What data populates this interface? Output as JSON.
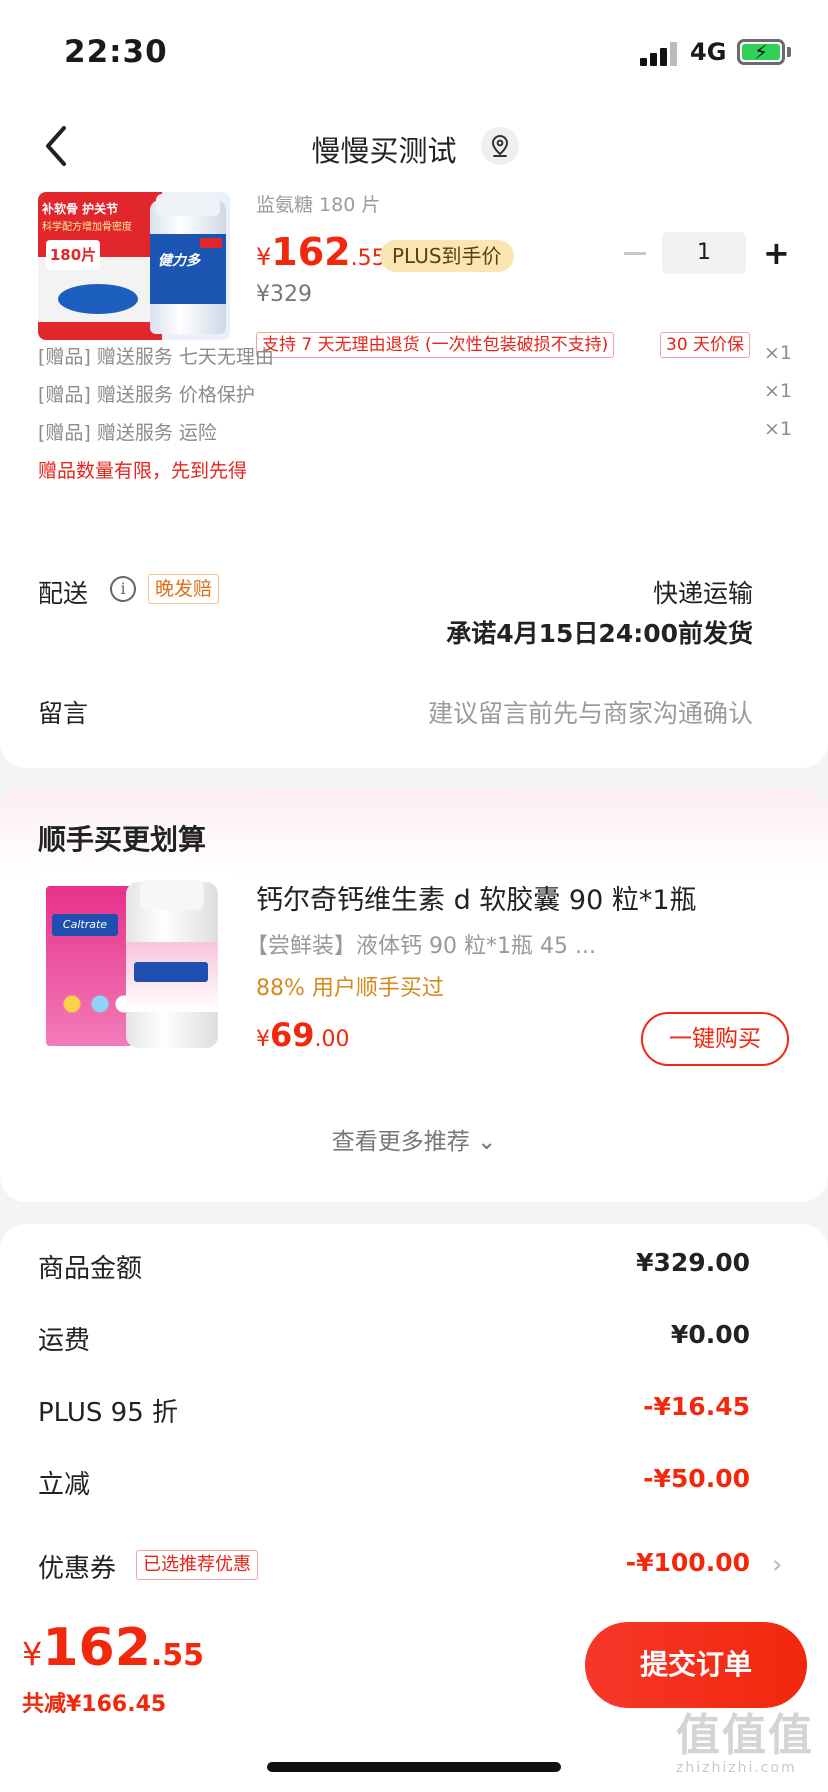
{
  "status_bar": {
    "time": "22:30",
    "network": "4G"
  },
  "nav": {
    "title": "慢慢买测试",
    "back_icon": "chevron-left-icon",
    "location_icon": "location-pin-icon"
  },
  "product": {
    "subtitle": "监氨糖 180 片",
    "price": {
      "symbol": "¥",
      "integer": "162",
      "decimal": ".55"
    },
    "plus_tag": "PLUS到手价",
    "quantity": "1",
    "original_price": "¥329",
    "tags": [
      "支持 7 天无理由退货 (一次性包装破损不支持)",
      "30 天价保"
    ],
    "image": {
      "line1": "补软骨 护关节",
      "line2": "科学配方增加骨密度",
      "count": "180片",
      "brand": "健力多"
    }
  },
  "gifts": [
    {
      "label": "[赠品]  赠送服务  七天无理由",
      "qty": "×1"
    },
    {
      "label": "[赠品]  赠送服务  价格保护",
      "qty": "×1"
    },
    {
      "label": "[赠品]  赠送服务  运险",
      "qty": "×1"
    }
  ],
  "gift_note": "赠品数量有限，先到先得",
  "delivery": {
    "label": "配送",
    "late_tag": "晚发赔",
    "method": "快递运输",
    "promise": "承诺4月15日24:00前发货"
  },
  "message": {
    "label": "留言",
    "placeholder": "建议留言前先与商家沟通确认"
  },
  "recommend": {
    "heading": "顺手买更划算",
    "name": "钙尔奇钙维生素 d 软胶囊 90 粒*1瓶",
    "sub": "【尝鲜装】液体钙 90 粒*1瓶 45 ...",
    "stat": "88% 用户顺手买过",
    "price": {
      "symbol": "¥",
      "integer": "69",
      "decimal": ".00"
    },
    "buy_label": "一键购买",
    "more_label": "查看更多推荐 ⌄",
    "image_brand": "Caltrate"
  },
  "summary": [
    {
      "label": "商品金额",
      "value": "¥329.00",
      "red": false
    },
    {
      "label": "运费",
      "value": "¥0.00",
      "red": false
    },
    {
      "label": "PLUS 95 折",
      "value": "-¥16.45",
      "red": true
    },
    {
      "label": "立减",
      "value": "-¥50.00",
      "red": true
    },
    {
      "label": "优惠券",
      "value": "-¥100.00",
      "red": true
    }
  ],
  "coupon_tag": "已选推荐优惠",
  "footer": {
    "total": {
      "symbol": "¥",
      "integer": "162",
      "decimal": ".55"
    },
    "saved": "共减¥166.45",
    "submit_label": "提交订单",
    "watermark": "值值值",
    "watermark_url": "zhizhizhi.com"
  },
  "colors": {
    "accent": "#f2270c",
    "plus_tag_bg": "#fbe5b1",
    "gift_note": "#e8231b",
    "battery": "#2fd157"
  }
}
